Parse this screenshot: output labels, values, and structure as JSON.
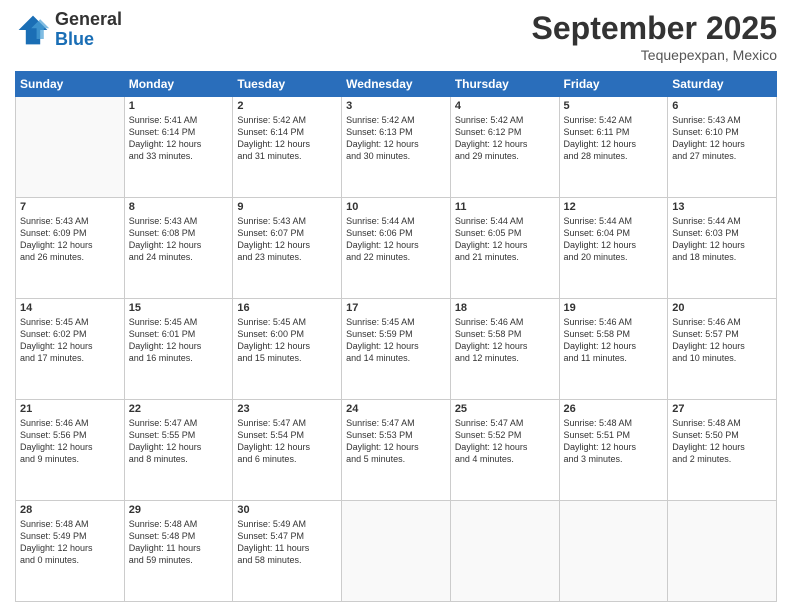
{
  "logo": {
    "line1": "General",
    "line2": "Blue"
  },
  "header": {
    "month": "September 2025",
    "location": "Tequepexpan, Mexico"
  },
  "weekdays": [
    "Sunday",
    "Monday",
    "Tuesday",
    "Wednesday",
    "Thursday",
    "Friday",
    "Saturday"
  ],
  "weeks": [
    [
      {
        "day": "",
        "info": ""
      },
      {
        "day": "1",
        "info": "Sunrise: 5:41 AM\nSunset: 6:14 PM\nDaylight: 12 hours\nand 33 minutes."
      },
      {
        "day": "2",
        "info": "Sunrise: 5:42 AM\nSunset: 6:14 PM\nDaylight: 12 hours\nand 31 minutes."
      },
      {
        "day": "3",
        "info": "Sunrise: 5:42 AM\nSunset: 6:13 PM\nDaylight: 12 hours\nand 30 minutes."
      },
      {
        "day": "4",
        "info": "Sunrise: 5:42 AM\nSunset: 6:12 PM\nDaylight: 12 hours\nand 29 minutes."
      },
      {
        "day": "5",
        "info": "Sunrise: 5:42 AM\nSunset: 6:11 PM\nDaylight: 12 hours\nand 28 minutes."
      },
      {
        "day": "6",
        "info": "Sunrise: 5:43 AM\nSunset: 6:10 PM\nDaylight: 12 hours\nand 27 minutes."
      }
    ],
    [
      {
        "day": "7",
        "info": "Sunrise: 5:43 AM\nSunset: 6:09 PM\nDaylight: 12 hours\nand 26 minutes."
      },
      {
        "day": "8",
        "info": "Sunrise: 5:43 AM\nSunset: 6:08 PM\nDaylight: 12 hours\nand 24 minutes."
      },
      {
        "day": "9",
        "info": "Sunrise: 5:43 AM\nSunset: 6:07 PM\nDaylight: 12 hours\nand 23 minutes."
      },
      {
        "day": "10",
        "info": "Sunrise: 5:44 AM\nSunset: 6:06 PM\nDaylight: 12 hours\nand 22 minutes."
      },
      {
        "day": "11",
        "info": "Sunrise: 5:44 AM\nSunset: 6:05 PM\nDaylight: 12 hours\nand 21 minutes."
      },
      {
        "day": "12",
        "info": "Sunrise: 5:44 AM\nSunset: 6:04 PM\nDaylight: 12 hours\nand 20 minutes."
      },
      {
        "day": "13",
        "info": "Sunrise: 5:44 AM\nSunset: 6:03 PM\nDaylight: 12 hours\nand 18 minutes."
      }
    ],
    [
      {
        "day": "14",
        "info": "Sunrise: 5:45 AM\nSunset: 6:02 PM\nDaylight: 12 hours\nand 17 minutes."
      },
      {
        "day": "15",
        "info": "Sunrise: 5:45 AM\nSunset: 6:01 PM\nDaylight: 12 hours\nand 16 minutes."
      },
      {
        "day": "16",
        "info": "Sunrise: 5:45 AM\nSunset: 6:00 PM\nDaylight: 12 hours\nand 15 minutes."
      },
      {
        "day": "17",
        "info": "Sunrise: 5:45 AM\nSunset: 5:59 PM\nDaylight: 12 hours\nand 14 minutes."
      },
      {
        "day": "18",
        "info": "Sunrise: 5:46 AM\nSunset: 5:58 PM\nDaylight: 12 hours\nand 12 minutes."
      },
      {
        "day": "19",
        "info": "Sunrise: 5:46 AM\nSunset: 5:58 PM\nDaylight: 12 hours\nand 11 minutes."
      },
      {
        "day": "20",
        "info": "Sunrise: 5:46 AM\nSunset: 5:57 PM\nDaylight: 12 hours\nand 10 minutes."
      }
    ],
    [
      {
        "day": "21",
        "info": "Sunrise: 5:46 AM\nSunset: 5:56 PM\nDaylight: 12 hours\nand 9 minutes."
      },
      {
        "day": "22",
        "info": "Sunrise: 5:47 AM\nSunset: 5:55 PM\nDaylight: 12 hours\nand 8 minutes."
      },
      {
        "day": "23",
        "info": "Sunrise: 5:47 AM\nSunset: 5:54 PM\nDaylight: 12 hours\nand 6 minutes."
      },
      {
        "day": "24",
        "info": "Sunrise: 5:47 AM\nSunset: 5:53 PM\nDaylight: 12 hours\nand 5 minutes."
      },
      {
        "day": "25",
        "info": "Sunrise: 5:47 AM\nSunset: 5:52 PM\nDaylight: 12 hours\nand 4 minutes."
      },
      {
        "day": "26",
        "info": "Sunrise: 5:48 AM\nSunset: 5:51 PM\nDaylight: 12 hours\nand 3 minutes."
      },
      {
        "day": "27",
        "info": "Sunrise: 5:48 AM\nSunset: 5:50 PM\nDaylight: 12 hours\nand 2 minutes."
      }
    ],
    [
      {
        "day": "28",
        "info": "Sunrise: 5:48 AM\nSunset: 5:49 PM\nDaylight: 12 hours\nand 0 minutes."
      },
      {
        "day": "29",
        "info": "Sunrise: 5:48 AM\nSunset: 5:48 PM\nDaylight: 11 hours\nand 59 minutes."
      },
      {
        "day": "30",
        "info": "Sunrise: 5:49 AM\nSunset: 5:47 PM\nDaylight: 11 hours\nand 58 minutes."
      },
      {
        "day": "",
        "info": ""
      },
      {
        "day": "",
        "info": ""
      },
      {
        "day": "",
        "info": ""
      },
      {
        "day": "",
        "info": ""
      }
    ]
  ]
}
